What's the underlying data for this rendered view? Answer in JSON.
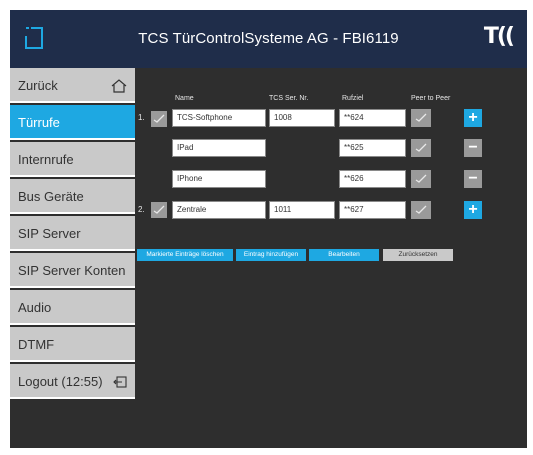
{
  "header": {
    "title": "TCS TürControlSysteme AG - FBI6119",
    "logo_text": "T(("
  },
  "sidebar": {
    "items": [
      {
        "label": "Zurück"
      },
      {
        "label": "Türrufe"
      },
      {
        "label": "Internrufe"
      },
      {
        "label": "Bus Geräte"
      },
      {
        "label": "SIP Server"
      },
      {
        "label": "SIP Server Konten"
      },
      {
        "label": "Audio"
      },
      {
        "label": "DTMF"
      },
      {
        "label": "Logout (12:55)"
      }
    ],
    "active": "Türrufe"
  },
  "table": {
    "headers": {
      "name": "Name",
      "ser_nr": "TCS Ser. Nr.",
      "rufziel": "Rufziel",
      "peer": "Peer to Peer"
    },
    "rows": [
      {
        "index": "1.",
        "name": "TCS-Softphone",
        "ser_nr": "1008",
        "rufziel": "**624",
        "action": "+"
      },
      {
        "index": "",
        "name": "IPad",
        "ser_nr": "",
        "rufziel": "**625",
        "action": "−"
      },
      {
        "index": "",
        "name": "IPhone",
        "ser_nr": "",
        "rufziel": "**626",
        "action": "−"
      },
      {
        "index": "2.",
        "name": "Zentrale",
        "ser_nr": "1011",
        "rufziel": "**627",
        "action": "+"
      }
    ]
  },
  "actions": {
    "delete_marked": "Markierte Einträge löschen",
    "add_entry": "Eintrag hinzufügen",
    "edit": "Bearbeiten",
    "reset": "Zurücksetzen"
  },
  "colors": {
    "header_bg": "#1f2d4a",
    "accent": "#1ea8e2",
    "sidebar_item": "#c9c9c9",
    "content_bg": "#2e2e2e"
  }
}
